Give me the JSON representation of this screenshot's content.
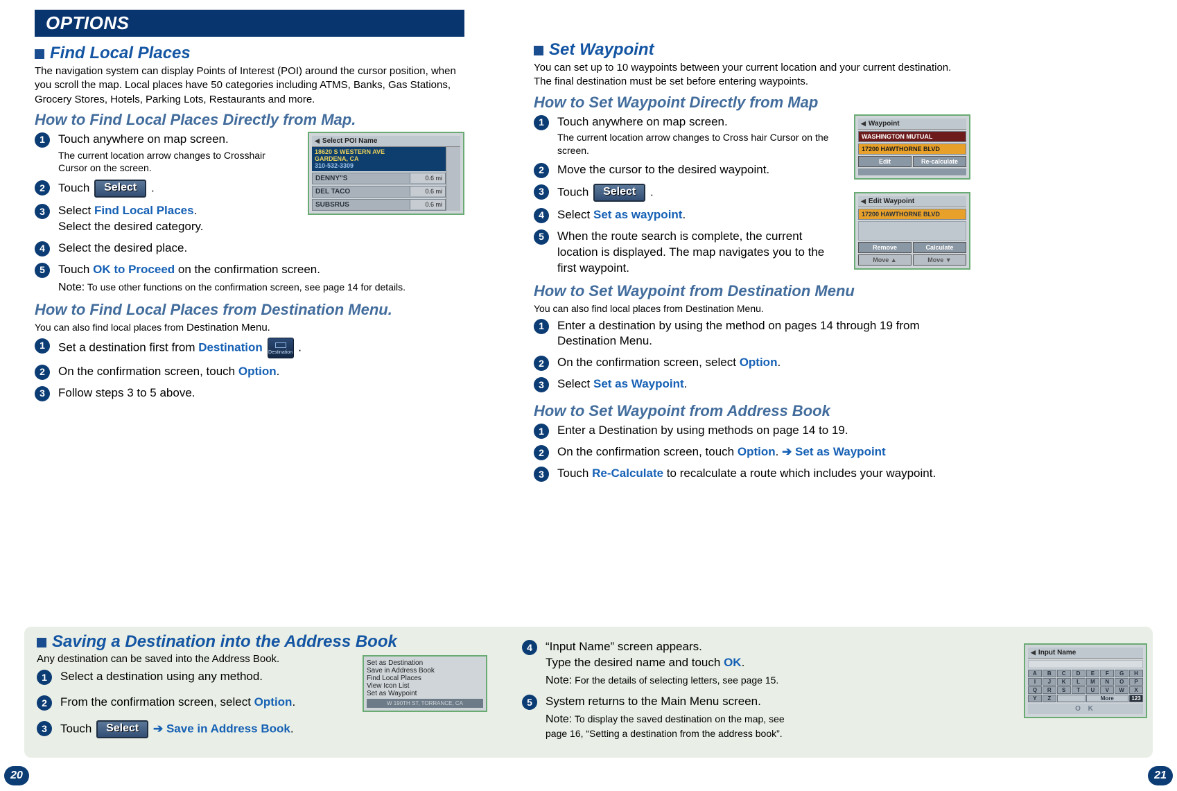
{
  "banner": "OPTIONS",
  "page_left": "20",
  "page_right": "21",
  "buttons": {
    "select": "Select",
    "destination_icon_caption": "Destination"
  },
  "left": {
    "sec1": {
      "title": "Find Local Places",
      "intro": "The navigation system can display Points of Interest (POI) around the cursor position, when you scroll the map. Local places have 50 categories including ATMS, Banks, Gas Stations, Grocery Stores, Hotels, Parking Lots, Restaurants and more.",
      "sub_a": "How to Find Local Places Directly from Map.",
      "steps_a": {
        "s1": "Touch anywhere on map screen.",
        "s1_small": "The current location arrow changes to Crosshair Cursor on the screen.",
        "s2_pre": "Touch ",
        "s2_post": ".",
        "s3_pre": "Select ",
        "s3_hl": "Find Local Places",
        "s3_post": ".",
        "s3_line2": "Select the desired category.",
        "s4": "Select the desired place.",
        "s5_pre": "Touch ",
        "s5_hl": "OK to Proceed",
        "s5_post": " on the confirmation  screen.",
        "s5_note_label": "Note:",
        "s5_note": " To use other functions on the confirmation screen, see page 14 for details."
      },
      "sub_b": "How to Find Local Places from Destination Menu.",
      "sub_b_intro_a": "You can also find local places from ",
      "sub_b_intro_b": "Destination Menu.",
      "steps_b": {
        "s1_pre": "Set a destination first from ",
        "s1_hl": "Destination",
        "s1_post": " .",
        "s2_pre": "On the confirmation screen, touch ",
        "s2_hl": "Option",
        "s2_post": ".",
        "s3": "Follow steps 3 to 5 above."
      }
    }
  },
  "right": {
    "sec1": {
      "title": "Set Waypoint",
      "intro": "You can set up to 10 waypoints between your current location and your current destination. The final destination must be set before entering waypoints.",
      "sub_a": "How to Set Waypoint Directly from Map",
      "steps_a": {
        "s1": "Touch anywhere on map screen.",
        "s1_small": "The current location arrow changes to Cross hair Cursor on the screen.",
        "s2": "Move the cursor to the desired waypoint.",
        "s3_pre": "Touch ",
        "s3_post": ".",
        "s4_pre": "Select ",
        "s4_hl": "Set as waypoint",
        "s4_post": ".",
        "s5": "When the route search is complete, the current location is displayed. The map navigates you to the first waypoint."
      },
      "sub_b": "How to Set Waypoint from Destination Menu",
      "sub_b_intro": "You can also find local places from Destination Menu.",
      "steps_b": {
        "s1": "Enter a destination by using the method on pages 14 through 19 from Destination Menu.",
        "s2_pre": "On the confirmation screen, select ",
        "s2_hl": "Option",
        "s2_post": ".",
        "s3_pre": "Select ",
        "s3_hl": "Set as Waypoint",
        "s3_post": "."
      },
      "sub_c": "How to Set Waypoint from Address Book",
      "steps_c": {
        "s1": "Enter a Destination by using methods on page 14 to 19.",
        "s2_pre": "On the confirmation screen, touch ",
        "s2_hl1": "Option",
        "s2_mid": ". ",
        "s2_arrow": "➔",
        "s2_hl2": " Set as Waypoint",
        "s3_pre": "Touch ",
        "s3_hl": "Re-Calculate",
        "s3_post": " to recalculate a route which includes your waypoint."
      }
    }
  },
  "greenbox": {
    "title": "Saving a Destination into the Address Book",
    "intro": "Any destination can be saved into the Address Book.",
    "left_steps": {
      "s1_pre": "Select a ",
      "s1_post": "destination using any method.",
      "s2_pre": "From the confirmation screen, select ",
      "s2_hl": "Option",
      "s2_post": ".",
      "s3_pre": "Touch ",
      "s3_arrow": "➔",
      "s3_hl": " Save in Address Book",
      "s3_post": "."
    },
    "right_steps": {
      "s4_a": "“Input Name” screen appears.",
      "s4_b_pre": " Type the desired name and touch ",
      "s4_b_hl": "OK",
      "s4_b_post": ".",
      "s4_note_label": "Note:",
      "s4_note": " For the details of selecting letters, see page 15.",
      "s5": "System returns to the Main Menu screen.",
      "s5_note_label": "Note:",
      "s5_note": " To display the saved destination on the map, see page 16, “Setting a destination from the address book”."
    }
  },
  "shots": {
    "poi": {
      "title": "Select POI Name",
      "addr1": "18620 S WESTERN AVE",
      "addr2": "GARDENA, CA",
      "addr3": "310-532-3309",
      "r1n": "DENNY\"S",
      "r1d": "0.6 mi",
      "r2n": "DEL TACO",
      "r2d": "0.6 mi",
      "r3n": "SUBSRUS",
      "r3d": "0.6 mi"
    },
    "wp": {
      "title": "Waypoint",
      "item1": "WASHINGTON MUTUAL",
      "item2": "17200 HAWTHORNE BLVD",
      "b1": "Edit",
      "b2": "Re-calculate"
    },
    "edit": {
      "title": "Edit Waypoint",
      "item1": "17200 HAWTHORNE BLVD",
      "b1": "Remove",
      "b2": "Calculate",
      "m1": "Move ▲",
      "m2": "Move ▼"
    },
    "opts": {
      "o1": "Set as Destination",
      "o2": "Save in Address Book",
      "o3": "Find Local Places",
      "o4": "View Icon List",
      "o5": "Set as Waypoint",
      "foot": "W 190TH ST, TORRANCE, CA"
    },
    "input": {
      "title": "Input Name",
      "keys": [
        "A",
        "B",
        "C",
        "D",
        "E",
        "F",
        "G",
        "H",
        "I",
        "J",
        "K",
        "L",
        "M",
        "N",
        "O",
        "P",
        "Q",
        "R",
        "S",
        "T",
        "U",
        "V",
        "W",
        "X",
        "Y",
        "Z"
      ],
      "more": "More",
      "num": "123",
      "ok": "O K"
    }
  }
}
